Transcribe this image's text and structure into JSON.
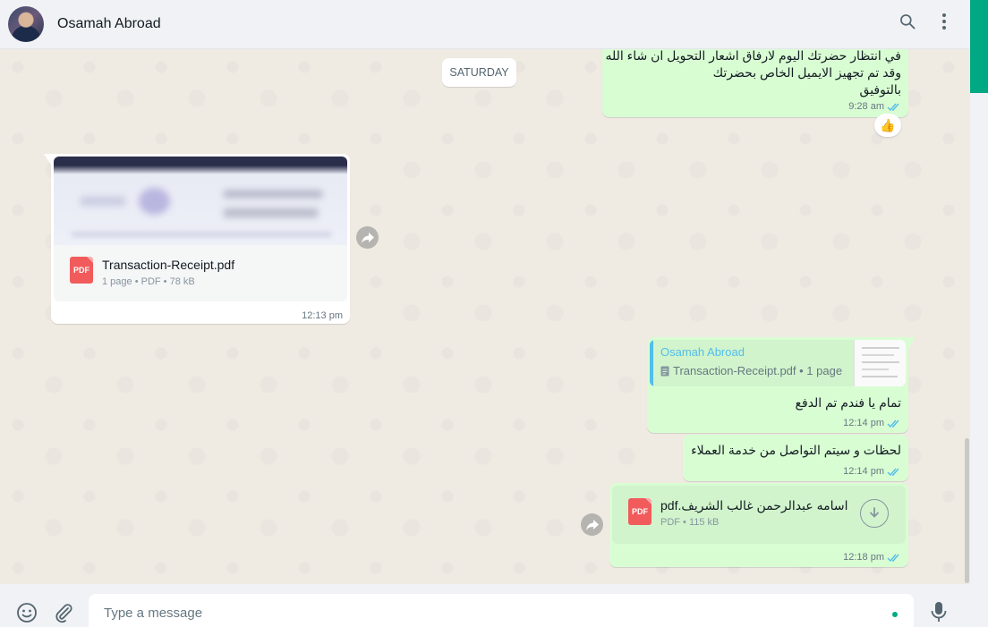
{
  "header": {
    "contact_name": "Osamah Abroad",
    "search_icon": "search-icon",
    "menu_icon": "menu-dots-icon"
  },
  "chat": {
    "date_chip": "SATURDAY",
    "msg1": {
      "line1": "في انتظار حضرتك اليوم لارفاق اشعار التحويل ان شاء الله",
      "line2": "وقد تم تجهيز الايميل الخاص بحضرتك",
      "line3": "بالتوفيق",
      "time": "9:28 am",
      "reaction": "👍"
    },
    "msg2": {
      "file_name": "Transaction-Receipt.pdf",
      "file_meta": "1 page • PDF • 78 kB",
      "icon_label": "PDF",
      "time": "12:13 pm"
    },
    "msg3": {
      "quote_author": "Osamah Abroad",
      "quote_text": "Transaction-Receipt.pdf • 1 page",
      "text": "تمام يا فندم تم الدفع",
      "time": "12:14 pm"
    },
    "msg4": {
      "text": "لحظات و سيتم التواصل من خدمة العملاء",
      "time": "12:14 pm"
    },
    "msg5": {
      "file_name": "اسامه عبدالرحمن غالب الشريف.pdf",
      "file_meta": "PDF • 115 kB",
      "icon_label": "PDF",
      "time": "12:18 pm"
    }
  },
  "footer": {
    "placeholder": "Type a message"
  },
  "colors": {
    "outgoing": "#d9fdd3",
    "incoming": "#ffffff",
    "accent": "#00a884",
    "quote_author": "#53bdeb"
  }
}
